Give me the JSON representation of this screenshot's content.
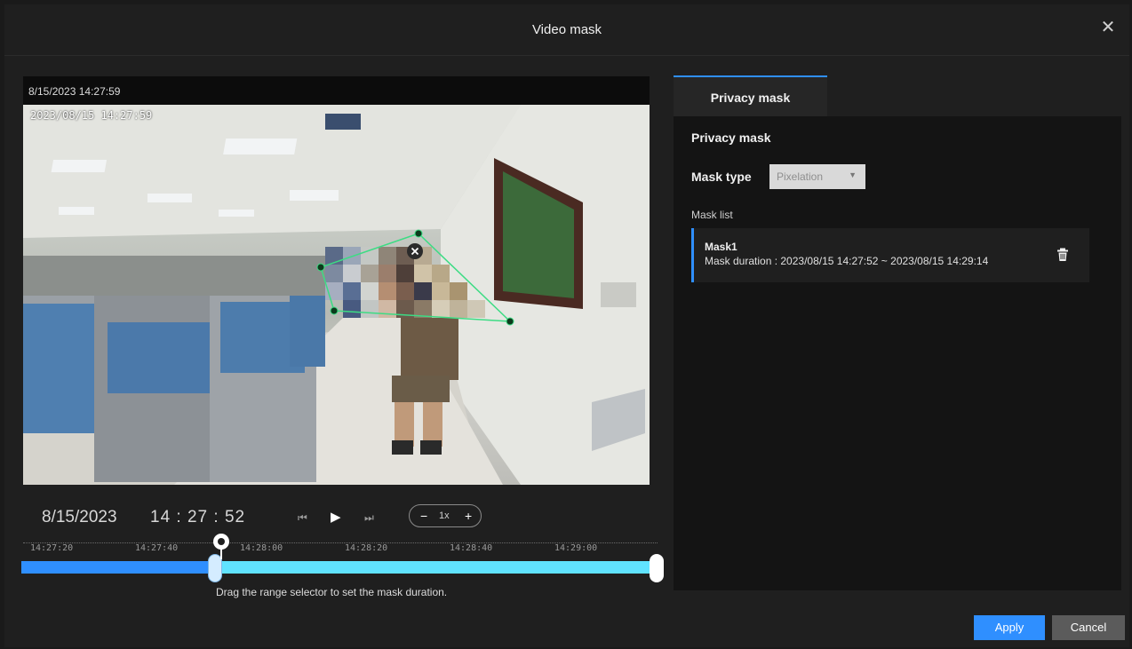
{
  "dialog": {
    "title": "Video mask",
    "close_symbol": "✕"
  },
  "video": {
    "header_timestamp": "8/15/2023 14:27:59",
    "osd_timestamp": "2023/08/15 14:27:59"
  },
  "playback": {
    "date": "8/15/2023",
    "time": "14 : 27 : 52",
    "prev_symbol": "⏮",
    "play_symbol": "▶",
    "next_symbol": "⏭",
    "zoom_out": "−",
    "speed": "1x",
    "zoom_in": "+"
  },
  "timeline": {
    "labels": [
      "14:27:20",
      "14:27:40",
      "14:28:00",
      "14:28:20",
      "14:28:40",
      "14:29:00"
    ],
    "hint": "Drag the range selector to set the mask duration."
  },
  "panel": {
    "tab_label": "Privacy mask",
    "heading": "Privacy mask",
    "mask_type_label": "Mask type",
    "mask_type_value": "Pixelation",
    "mask_list_label": "Mask list",
    "masks": [
      {
        "name": "Mask1",
        "duration": "Mask duration : 2023/08/15 14:27:52 ~ 2023/08/15 14:29:14"
      }
    ]
  },
  "footer": {
    "apply_label": "Apply",
    "cancel_label": "Cancel"
  },
  "colors": {
    "accent": "#2f8fff",
    "range": "#60e3ff",
    "mask_outline": "#3ddc84"
  }
}
